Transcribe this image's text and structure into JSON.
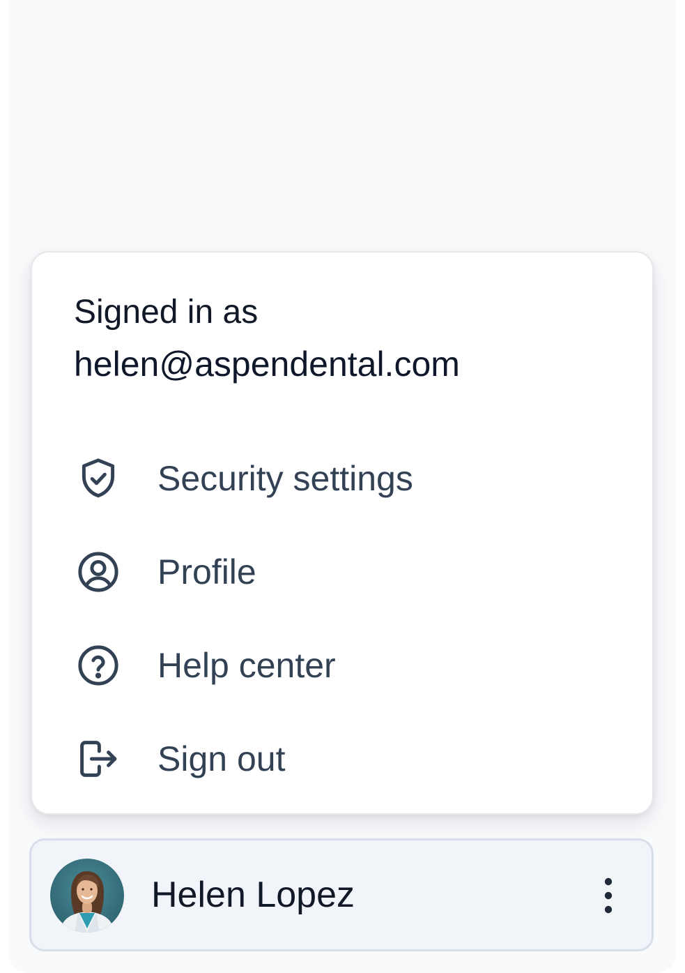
{
  "menu": {
    "signed_in_label": "Signed in as",
    "signed_in_email": "helen@aspendental.com",
    "items": [
      {
        "label": "Security settings",
        "icon": "shield-check-icon"
      },
      {
        "label": "Profile",
        "icon": "user-circle-icon"
      },
      {
        "label": "Help center",
        "icon": "question-circle-icon"
      },
      {
        "label": "Sign out",
        "icon": "sign-out-icon"
      }
    ]
  },
  "user": {
    "name": "Helen Lopez",
    "avatar": "avatar-photo",
    "more_icon": "more-vertical-icon"
  },
  "colors": {
    "panel_bg": "#f8fafc",
    "menu_bg": "#ffffff",
    "text_primary": "#111827",
    "text_menu": "#334155",
    "card_bg": "#f1f5f9",
    "card_border": "#d6dee8"
  }
}
